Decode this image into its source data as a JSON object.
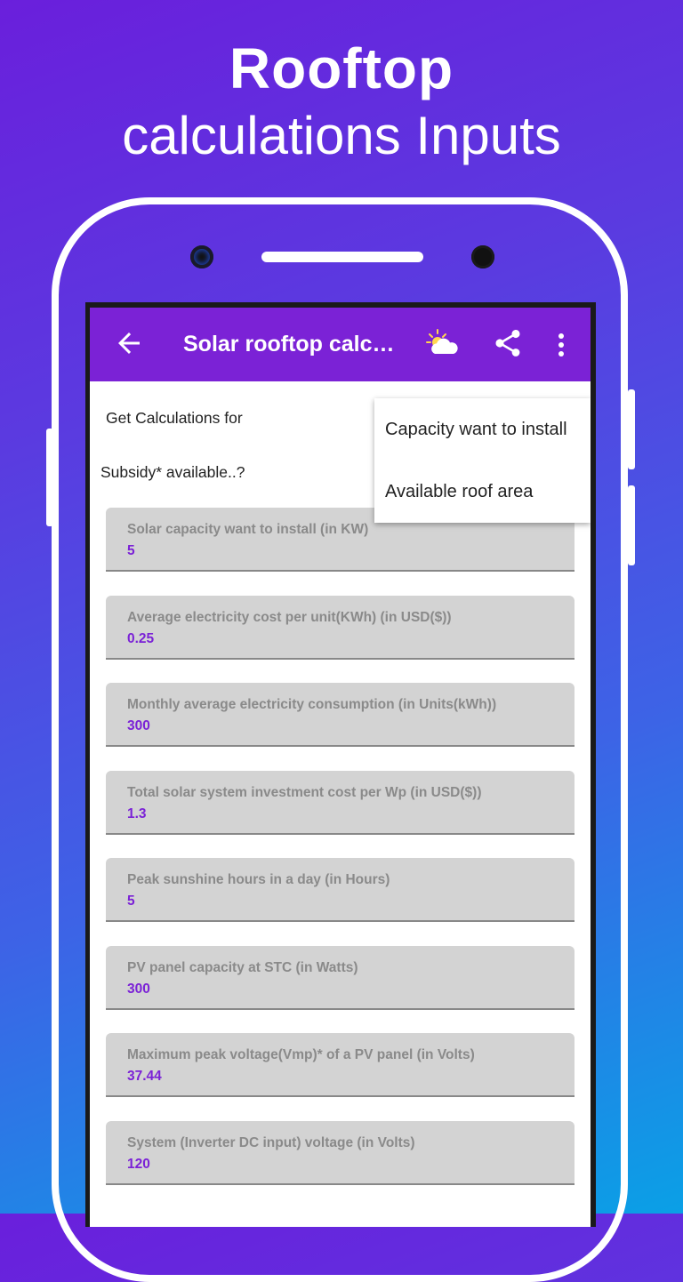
{
  "headline": {
    "line1": "Rooftop",
    "line2": "calculations Inputs"
  },
  "appbar": {
    "title": "Solar rooftop calc…",
    "bg_color": "#7b22d6"
  },
  "labels": {
    "get_calculations": "Get Calculations for",
    "subsidy": "Subsidy* available..?"
  },
  "popup": {
    "items": [
      "Capacity want to install",
      "Available roof area"
    ]
  },
  "fields": [
    {
      "label": "Solar capacity want to install (in KW)",
      "value": "5"
    },
    {
      "label": "Average electricity cost per unit(KWh) (in USD($))",
      "value": "0.25"
    },
    {
      "label": "Monthly average electricity consumption (in Units(kWh))",
      "value": "300"
    },
    {
      "label": "Total solar system investment cost per Wp (in USD($))",
      "value": "1.3"
    },
    {
      "label": "Peak sunshine hours in a day (in Hours)",
      "value": "5"
    },
    {
      "label": "PV panel capacity at STC (in Watts)",
      "value": "300"
    },
    {
      "label": "Maximum peak voltage(Vmp)* of a PV panel (in Volts)",
      "value": "37.44"
    },
    {
      "label": "System (Inverter DC input) voltage (in Volts)",
      "value": "120"
    }
  ],
  "icons": [
    "back-arrow-icon",
    "weather-icon",
    "share-icon",
    "more-vert-icon"
  ]
}
